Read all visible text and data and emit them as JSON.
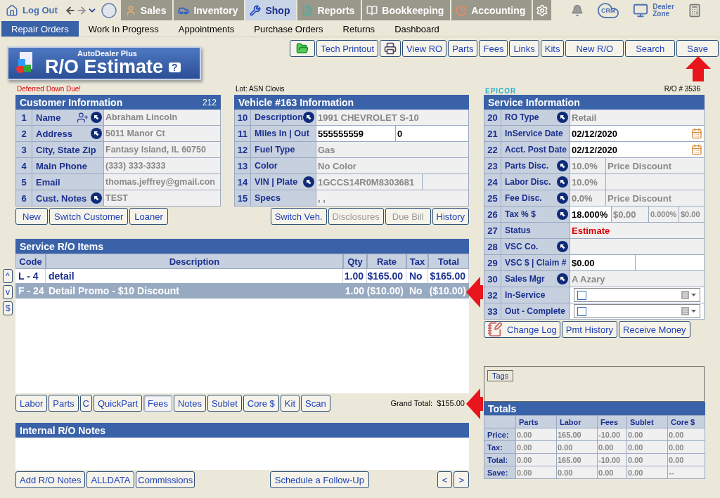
{
  "top_nav": {
    "logout": "Log Out",
    "modules": [
      {
        "label": "Sales",
        "selected": false
      },
      {
        "label": "Inventory",
        "selected": false
      },
      {
        "label": "Shop",
        "selected": true
      },
      {
        "label": "Reports",
        "selected": false
      },
      {
        "label": "Bookkeeping",
        "selected": false
      },
      {
        "label": "Accounting",
        "selected": false
      }
    ],
    "crm": "CRM",
    "dealer_zone": "Dealer Zone"
  },
  "sub_nav": [
    {
      "label": "Repair Orders",
      "selected": true
    },
    {
      "label": "Work In Progress",
      "selected": false
    },
    {
      "label": "Appointments",
      "selected": false
    },
    {
      "label": "Purchase Orders",
      "selected": false
    },
    {
      "label": "Returns",
      "selected": false
    },
    {
      "label": "Dashboard",
      "selected": false
    }
  ],
  "logo": {
    "brand": "AutoDealer Plus",
    "title": "R/O Estimate",
    "help": "?"
  },
  "toolbar": [
    {
      "kind": "folder"
    },
    {
      "kind": "text",
      "label": "Tech Printout"
    },
    {
      "kind": "printer"
    },
    {
      "kind": "text",
      "label": "View RO"
    },
    {
      "kind": "text",
      "label": "Parts"
    },
    {
      "kind": "text",
      "label": "Fees"
    },
    {
      "kind": "text",
      "label": "Links"
    },
    {
      "kind": "text",
      "label": "Kits"
    },
    {
      "kind": "text",
      "label": "New R/O"
    },
    {
      "kind": "text",
      "label": "Search"
    },
    {
      "kind": "text",
      "label": "Save"
    }
  ],
  "customer": {
    "alert": "Deferred Down Due!",
    "title": "Customer Information",
    "count": "212",
    "rows": [
      {
        "num": "1",
        "label": "Name",
        "add_person": true,
        "link": true,
        "cells": [
          {
            "kind": "text",
            "text": "Abraham Lincoln"
          }
        ]
      },
      {
        "num": "2",
        "label": "Address",
        "add_person": false,
        "link": true,
        "cells": [
          {
            "kind": "text",
            "text": "5011 Manor Ct"
          }
        ]
      },
      {
        "num": "3",
        "label": "City, State Zip",
        "add_person": false,
        "link": false,
        "cells": [
          {
            "kind": "text",
            "text": "Fantasy Island, IL 60750"
          }
        ]
      },
      {
        "num": "4",
        "label": "Main Phone",
        "add_person": false,
        "link": false,
        "cells": [
          {
            "kind": "text",
            "text": "(333) 333-3333"
          }
        ]
      },
      {
        "num": "5",
        "label": "Email",
        "add_person": false,
        "link": false,
        "cells": [
          {
            "kind": "text",
            "text": "thomas.jeffrey@gmail.con"
          }
        ]
      },
      {
        "num": "6",
        "label": "Cust. Notes",
        "add_person": false,
        "link": true,
        "cells": [
          {
            "kind": "text",
            "text": "TEST"
          }
        ]
      }
    ],
    "buttons": [
      {
        "label": "New",
        "disabled": false
      },
      {
        "label": "Switch Customer",
        "disabled": false
      },
      {
        "label": "Loaner",
        "disabled": false
      }
    ]
  },
  "vehicle": {
    "lot": "Lot: ASN Clovis",
    "title": "Vehicle #163 Information",
    "rows": [
      {
        "num": "10",
        "label": "Description",
        "link": true,
        "cells": [
          {
            "kind": "text",
            "text": "1991 CHEVROLET S-10"
          }
        ]
      },
      {
        "num": "11",
        "label": "Miles  In | Out",
        "link": false,
        "cells": [
          {
            "kind": "input",
            "text": "555555559"
          },
          {
            "kind": "input",
            "text": "0"
          }
        ]
      },
      {
        "num": "12",
        "label": "Fuel Type",
        "link": false,
        "cells": [
          {
            "kind": "text",
            "text": "Gas"
          }
        ]
      },
      {
        "num": "13",
        "label": "Color",
        "link": false,
        "cells": [
          {
            "kind": "text",
            "text": "No Color"
          }
        ]
      },
      {
        "num": "14",
        "label": "VIN | Plate",
        "link": true,
        "cells": [
          {
            "kind": "text",
            "text": "1GCCS14R0M8303681"
          },
          {
            "kind": "text"
          }
        ]
      },
      {
        "num": "15",
        "label": "Specs",
        "link": false,
        "cells": [
          {
            "kind": "text",
            "text": ", ,"
          }
        ]
      }
    ],
    "buttons": [
      {
        "label": "Switch Veh.",
        "disabled": false
      },
      {
        "label": "Disclosures",
        "disabled": true
      },
      {
        "label": "Due Bill",
        "disabled": true
      },
      {
        "label": "History",
        "disabled": false
      }
    ]
  },
  "items": {
    "title": "Service R/O Items",
    "side_buttons": [
      "^",
      "v",
      "$"
    ],
    "columns": [
      "Code",
      "Description",
      "Qty",
      "Rate",
      "Tax",
      "Total"
    ],
    "rows": [
      {
        "selected": false,
        "cells": [
          "L - 4",
          "detail",
          "1.00",
          "$165.00",
          "No",
          "$165.00"
        ]
      },
      {
        "selected": true,
        "cells": [
          "F - 24",
          "Detail Promo - $10 Discount",
          "1.00",
          "($10.00)",
          "No",
          "($10.00)"
        ]
      }
    ],
    "buttons": [
      {
        "label": "Labor",
        "pressed": false
      },
      {
        "label": "Parts",
        "pressed": false
      },
      {
        "label": "C",
        "pressed": false
      },
      {
        "label": "QuickPart",
        "pressed": false
      },
      {
        "label": "Fees",
        "pressed": true
      },
      {
        "label": "Notes",
        "pressed": false
      },
      {
        "label": "Sublet",
        "pressed": false
      },
      {
        "label": "Core $",
        "pressed": false
      },
      {
        "label": "Kit",
        "pressed": false
      },
      {
        "label": "Scan",
        "pressed": false
      }
    ],
    "grand_total": {
      "label": "Grand Total:",
      "value": "$155.00"
    }
  },
  "notes": {
    "title": "Internal R/O Notes",
    "buttons": [
      "Add R/O Notes",
      "ALLDATA",
      "Commissions"
    ],
    "follow_up": "Schedule a Follow-Up",
    "pager": [
      "<",
      ">"
    ]
  },
  "service": {
    "brand": "EPICOR",
    "ro_number": "R/O # 3536",
    "title": "Service Information",
    "rows": [
      {
        "num": "20",
        "label": "RO Type",
        "link": true,
        "cells": [
          {
            "kind": "text",
            "text": "Retail"
          }
        ]
      },
      {
        "num": "21",
        "label": "InService Date",
        "link": false,
        "cells": [
          {
            "kind": "date",
            "text": "02/12/2020"
          }
        ]
      },
      {
        "num": "22",
        "label": "Acct. Post Date",
        "link": false,
        "cells": [
          {
            "kind": "date",
            "text": "02/12/2020"
          }
        ]
      },
      {
        "num": "23",
        "label": "Parts Disc.",
        "link": true,
        "cells": [
          {
            "kind": "text",
            "text": "10.0%"
          },
          {
            "kind": "text",
            "text": "Price Discount"
          }
        ]
      },
      {
        "num": "24",
        "label": "Labor Disc.",
        "link": true,
        "cells": [
          {
            "kind": "text",
            "text": "10.0%"
          },
          {
            "kind": "text"
          }
        ]
      },
      {
        "num": "25",
        "label": "Fee Disc.",
        "link": true,
        "cells": [
          {
            "kind": "text",
            "text": "0.0%"
          },
          {
            "kind": "text",
            "text": "Price Discount"
          }
        ]
      },
      {
        "num": "26",
        "label": "Tax % $",
        "link": true,
        "cells": [
          {
            "kind": "input",
            "text": "18.000%"
          },
          {
            "kind": "text",
            "text": "$0.00"
          },
          {
            "kind": "text",
            "text": "0.000%"
          },
          {
            "kind": "text",
            "text": "$0.00"
          }
        ]
      },
      {
        "num": "27",
        "label": "Status",
        "link": false,
        "cells": [
          {
            "kind": "alert",
            "text": "Estimate"
          }
        ]
      },
      {
        "num": "28",
        "label": "VSC  Co.",
        "link": true,
        "cells": [
          {
            "kind": "text"
          }
        ]
      },
      {
        "num": "29",
        "label": "VSC $ | Claim #",
        "link": false,
        "cells": [
          {
            "kind": "input",
            "text": "$0.00"
          },
          {
            "kind": "input"
          }
        ]
      },
      {
        "num": "30",
        "label": "Sales Mgr",
        "link": true,
        "cells": [
          {
            "kind": "text",
            "text": "A Azary"
          }
        ]
      },
      {
        "num": "32",
        "label": "In-Service",
        "link": false,
        "cells": [
          {
            "kind": "check",
            "checked": false
          }
        ]
      },
      {
        "num": "33",
        "label": "Out - Complete",
        "link": false,
        "cells": [
          {
            "kind": "check",
            "checked": false
          }
        ]
      }
    ],
    "buttons": [
      {
        "kind": "log",
        "label": "Change Log"
      },
      {
        "kind": "text",
        "label": "Pmt History"
      },
      {
        "kind": "text",
        "label": "Receive Money"
      }
    ]
  },
  "tags": {
    "label": "Tags"
  },
  "totals": {
    "title": "Totals",
    "columns": [
      "Parts",
      "Labor",
      "Fees",
      "Sublet",
      "Core $"
    ],
    "rows": [
      {
        "label": "Price:",
        "values": [
          "0.00",
          "165.00",
          "-10.00",
          "0.00",
          "0.00"
        ]
      },
      {
        "label": "Tax:",
        "values": [
          "0.00",
          "0.00",
          "0.00",
          "0.00",
          "0.00"
        ]
      },
      {
        "label": "Total:",
        "values": [
          "0.00",
          "165.00",
          "-10.00",
          "0.00",
          "0.00"
        ]
      },
      {
        "label": "Save:",
        "values": [
          "0.00",
          "0.00",
          "0.00",
          "0.00",
          "--"
        ]
      }
    ]
  }
}
